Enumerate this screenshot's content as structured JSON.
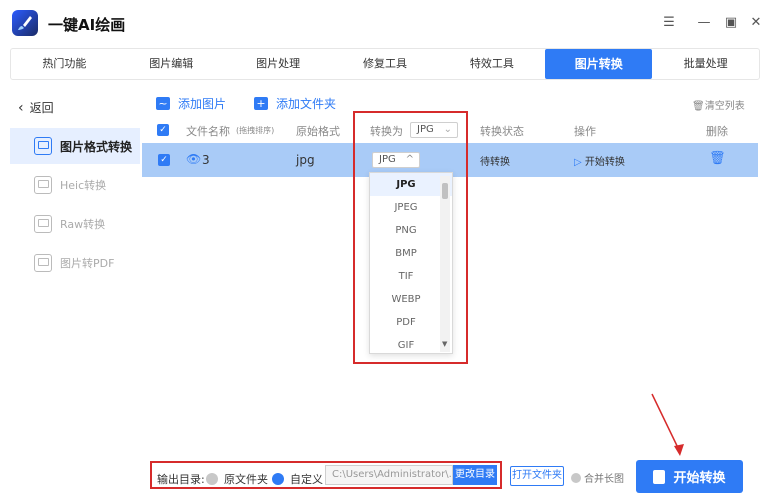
{
  "app": {
    "title": "一键AI绘画"
  },
  "tabs": [
    {
      "label": "热门功能"
    },
    {
      "label": "图片编辑"
    },
    {
      "label": "图片处理"
    },
    {
      "label": "修复工具"
    },
    {
      "label": "特效工具"
    },
    {
      "label": "图片转换"
    },
    {
      "label": "批量处理"
    }
  ],
  "sidebar": {
    "back": "返回",
    "items": [
      {
        "label": "图片格式转换"
      },
      {
        "label": "Heic转换"
      },
      {
        "label": "Raw转换"
      },
      {
        "label": "图片转PDF"
      }
    ]
  },
  "toolbar": {
    "add_image": "添加图片",
    "add_folder": "添加文件夹",
    "clear_list": "清空列表"
  },
  "table": {
    "headers": {
      "filename": "文件名称",
      "filename_hint": "(拖拽排序)",
      "original_format": "原始格式",
      "convert_to": "转换为",
      "convert_to_value": "JPG",
      "status": "转换状态",
      "action": "操作",
      "delete": "删除"
    },
    "rows": [
      {
        "name": "3",
        "format": "jpg",
        "target": "JPG",
        "status": "待转换",
        "action": "开始转换"
      }
    ]
  },
  "dropdown": {
    "options": [
      "JPG",
      "JPEG",
      "PNG",
      "BMP",
      "TIF",
      "WEBP",
      "PDF",
      "GIF"
    ],
    "selected": "JPG"
  },
  "bottom": {
    "output_label": "输出目录:",
    "original_folder": "原文件夹",
    "custom": "自定义",
    "path": "C:\\Users\\Administrator\\...",
    "change_dir": "更改目录",
    "open_folder": "打开文件夹",
    "merge_long": "合并长图",
    "start": "开始转换"
  },
  "colors": {
    "accent": "#2f7bf5",
    "highlight": "#d62b2b",
    "row": "#a9cbf7"
  }
}
